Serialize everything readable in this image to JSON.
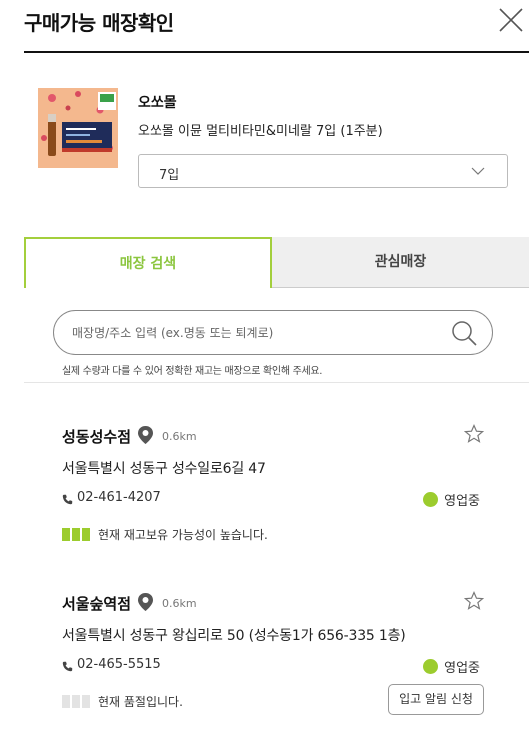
{
  "header": {
    "title": "구매가능 매장확인",
    "close_icon": "close-icon"
  },
  "product": {
    "brand": "오쏘몰",
    "name": "오쏘몰 이뮨 멀티비타민&미네랄 7입 (1주분)",
    "option_selected": "7입",
    "thumb_color": "#f3b489"
  },
  "tabs": [
    {
      "label": "매장 검색",
      "active": true
    },
    {
      "label": "관심매장",
      "active": false
    }
  ],
  "search": {
    "placeholder": "매장명/주소 입력 (ex.명동 또는 퇴계로)",
    "notice": "실제 수량과 다를 수 있어 정확한 재고는 매장으로 확인해 주세요."
  },
  "stores": [
    {
      "name": "성동성수점",
      "distance": "0.6km",
      "address": "서울특별시 성동구 성수일로6길 47",
      "phone": "02-461-4207",
      "status": "영업중",
      "stock_text": "현재 재고보유 가능성이 높습니다.",
      "stock_level": 3
    },
    {
      "name": "서울숲역점",
      "distance": "0.6km",
      "address": "서울특별시 성동구 왕십리로 50 (성수동1가 656-335 1층)",
      "phone": "02-465-5515",
      "status": "영업중",
      "stock_text": "현재 품절입니다.",
      "stock_level": 0,
      "restock_label": "입고 알림 신청"
    }
  ],
  "colors": {
    "accent": "#8cc63f",
    "status_open": "#9ccc2e",
    "stock_on": "#9ccc2e",
    "stock_off": "#e3e3e3"
  }
}
